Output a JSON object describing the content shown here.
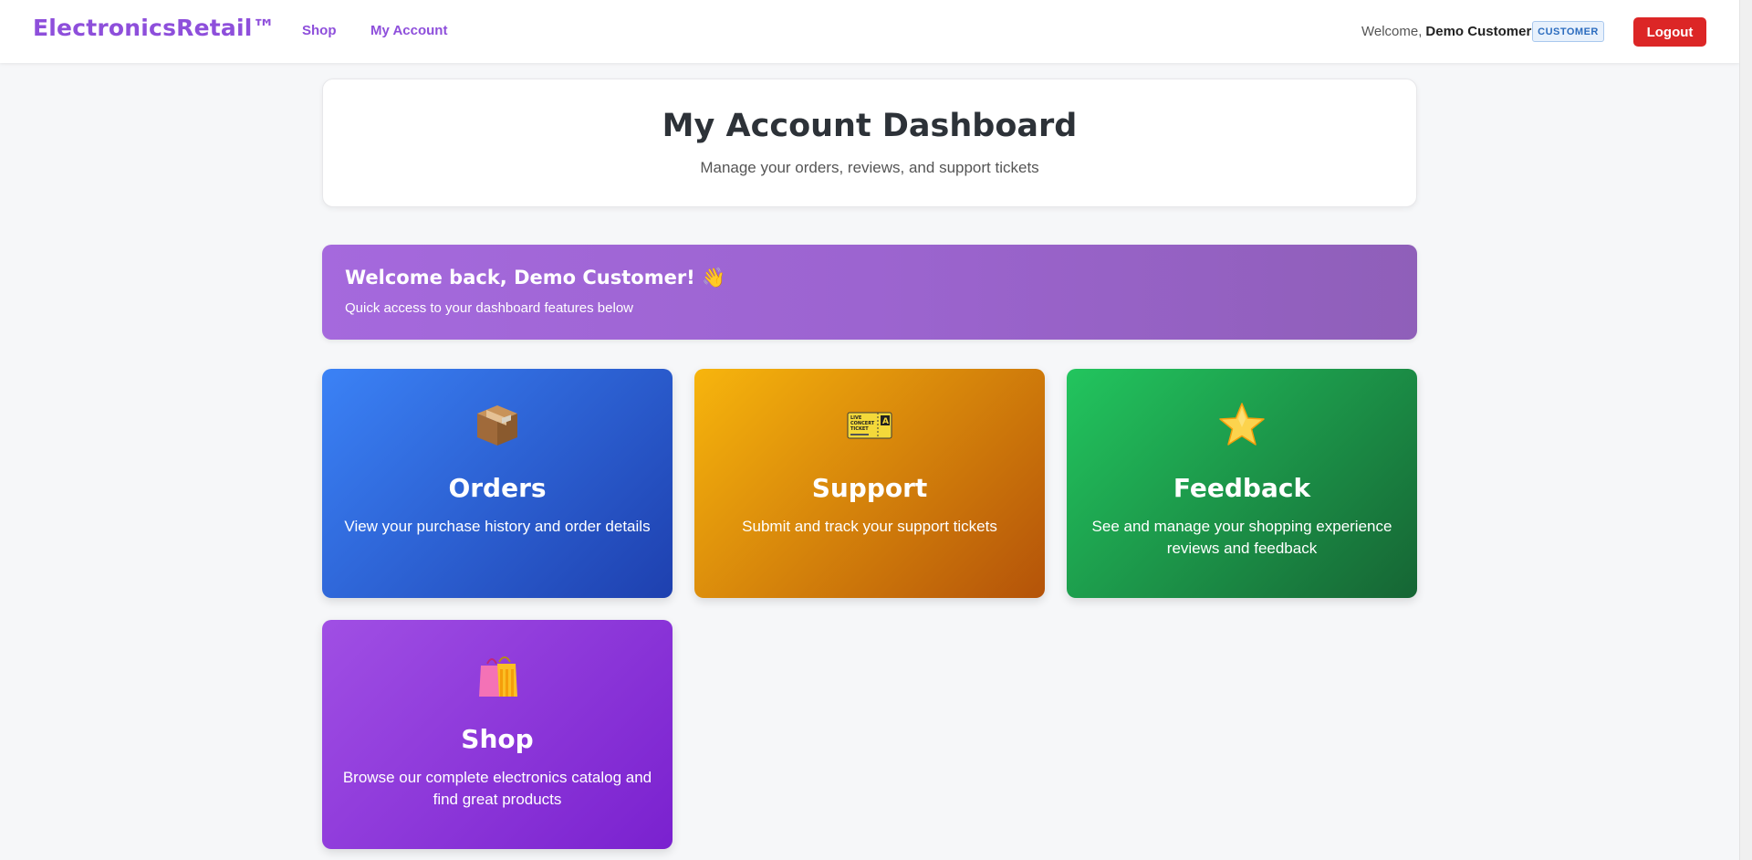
{
  "navbar": {
    "brand": "ElectronicsRetail™",
    "links": [
      "Shop",
      "My Account"
    ],
    "welcome_prefix": "Welcome,",
    "user_name": "Demo Customer",
    "role_badge": "CUSTOMER",
    "logout_label": "Logout"
  },
  "header": {
    "title": "My Account Dashboard",
    "subtitle": "Manage your orders, reviews, and support tickets"
  },
  "banner": {
    "title": "Welcome back, Demo Customer! 👋",
    "subtitle": "Quick access to your dashboard features below"
  },
  "cards": [
    {
      "icon": "package-icon",
      "title": "Orders",
      "description": "View your purchase history and order details"
    },
    {
      "icon": "ticket-icon",
      "title": "Support",
      "description": "Submit and track your support tickets"
    },
    {
      "icon": "star-icon",
      "title": "Feedback",
      "description": "See and manage your shopping experience reviews and feedback"
    },
    {
      "icon": "shopping-bags-icon",
      "title": "Shop",
      "description": "Browse our complete electronics catalog and find great products"
    }
  ],
  "ticket_icon_text": [
    "LIVE",
    "CONCERT",
    "TICKET",
    "A"
  ],
  "colors": {
    "brand": "#8e4fdb",
    "logout": "#dc2626",
    "orders": "#3b82f6",
    "support": "#f7b50d",
    "feedback": "#22c55e",
    "shop": "#a04fe4"
  }
}
